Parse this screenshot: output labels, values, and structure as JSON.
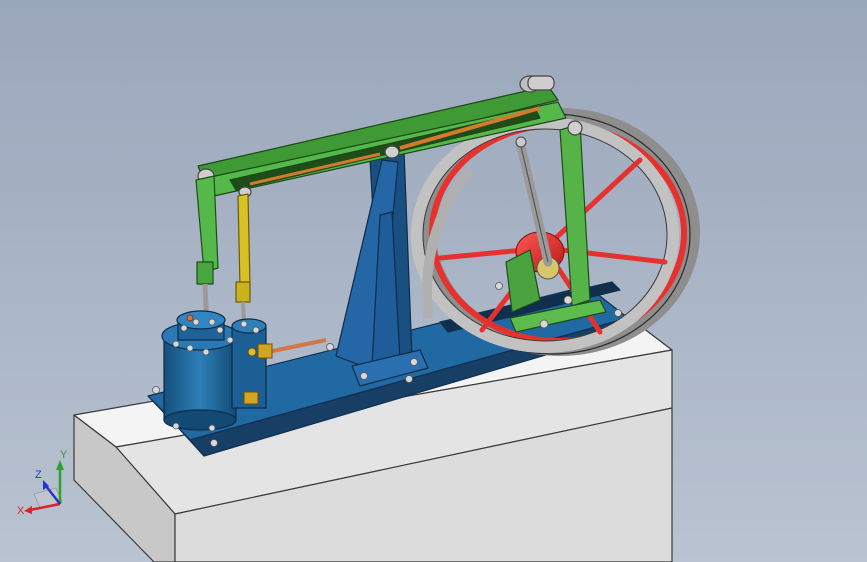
{
  "viewport": {
    "background_top": "#9aa7bb",
    "background_bottom": "#b9c3d1"
  },
  "colors": {
    "base_block": "#ececec",
    "base_plate": "#1f5f95",
    "standard": "#1f5c9a",
    "beam": "#49a83d",
    "flywheel_rim": "#a9a9a9",
    "flywheel_spokes": "#e7312f",
    "cylinder": "#1e6aa0",
    "rod_yellow": "#d7c125",
    "brass": "#d1a61e",
    "copper_pipe": "#d1774a",
    "steel": "#bfbfbf"
  },
  "triad": {
    "x_label": "X",
    "y_label": "Y",
    "z_label": "Z",
    "x_color": "#d8232a",
    "y_color": "#2fa12f",
    "z_color": "#2535c9"
  }
}
